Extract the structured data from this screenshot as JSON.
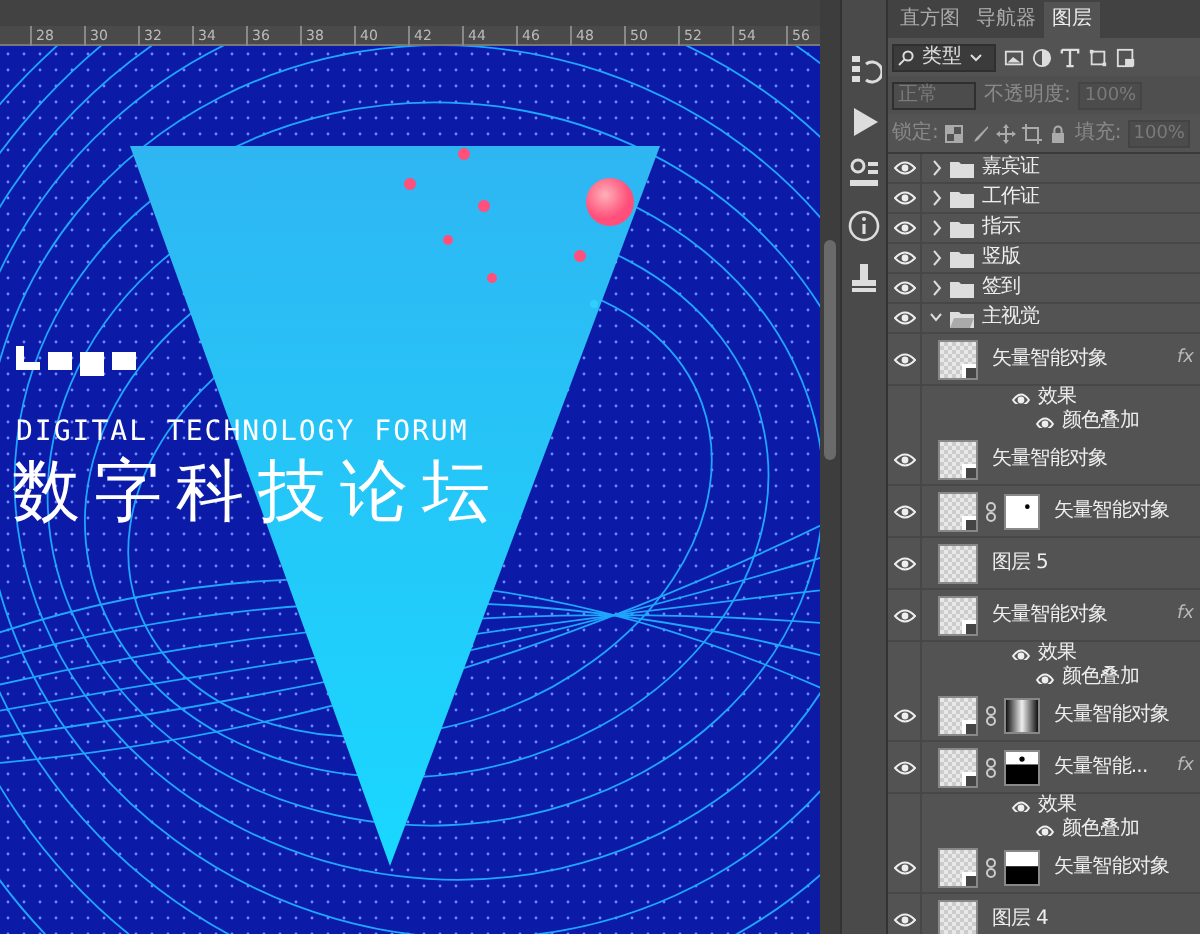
{
  "canvas": {
    "ruler_marks": [
      "28",
      "30",
      "32",
      "34",
      "36",
      "38",
      "40",
      "42",
      "44",
      "46",
      "48",
      "50",
      "52",
      "54",
      "56"
    ],
    "title_en": "DIGITAL TECHNOLOGY FORUM",
    "title_zh": "数字科技论坛"
  },
  "panel": {
    "tabs": [
      {
        "label": "直方图",
        "selected": false
      },
      {
        "label": "导航器",
        "selected": false
      },
      {
        "label": "图层",
        "selected": true
      }
    ],
    "filter": {
      "value": "类型"
    },
    "blend_mode": {
      "value": "正常",
      "disabled": true
    },
    "opacity": {
      "label": "不透明度:",
      "value": "100%",
      "disabled": true
    },
    "lock": {
      "label": "锁定:"
    },
    "fill": {
      "label": "填充:",
      "value": "100%",
      "disabled": true
    }
  },
  "layers": [
    {
      "kind": "folder",
      "name": "嘉宾证",
      "visible": true,
      "expanded": false
    },
    {
      "kind": "folder",
      "name": "工作证",
      "visible": true,
      "expanded": false
    },
    {
      "kind": "folder",
      "name": "指示",
      "visible": true,
      "expanded": false
    },
    {
      "kind": "folder",
      "name": "竖版",
      "visible": true,
      "expanded": false
    },
    {
      "kind": "folder",
      "name": "签到",
      "visible": true,
      "expanded": false
    },
    {
      "kind": "folder",
      "name": "主视觉",
      "visible": true,
      "expanded": true
    },
    {
      "kind": "smart",
      "name": "矢量智能对象",
      "visible": true,
      "fx": "fx"
    },
    {
      "kind": "effects",
      "name": "效果",
      "visible": true
    },
    {
      "kind": "effect",
      "name": "颜色叠加",
      "visible": true
    },
    {
      "kind": "smart",
      "name": "矢量智能对象",
      "visible": true
    },
    {
      "kind": "smart",
      "name": "矢量智能对象",
      "visible": true,
      "mask": {
        "kind": "dot"
      }
    },
    {
      "kind": "pixel",
      "name": "图层 5",
      "visible": true
    },
    {
      "kind": "smart",
      "name": "矢量智能对象",
      "visible": true,
      "fx": "fx"
    },
    {
      "kind": "effects",
      "name": "效果",
      "visible": true
    },
    {
      "kind": "effect",
      "name": "颜色叠加",
      "visible": true
    },
    {
      "kind": "smart",
      "name": "矢量智能对象",
      "visible": true,
      "mask": {
        "kind": "gradient"
      }
    },
    {
      "kind": "smart",
      "name": "矢量智能...",
      "visible": true,
      "fx": "fx",
      "mask": {
        "kind": "spot"
      }
    },
    {
      "kind": "effects",
      "name": "效果",
      "visible": true
    },
    {
      "kind": "effect",
      "name": "颜色叠加",
      "visible": true
    },
    {
      "kind": "smart",
      "name": "矢量智能对象",
      "visible": true,
      "mask": {
        "kind": "split"
      }
    },
    {
      "kind": "pixel",
      "name": "图层 4",
      "visible": true
    }
  ]
}
